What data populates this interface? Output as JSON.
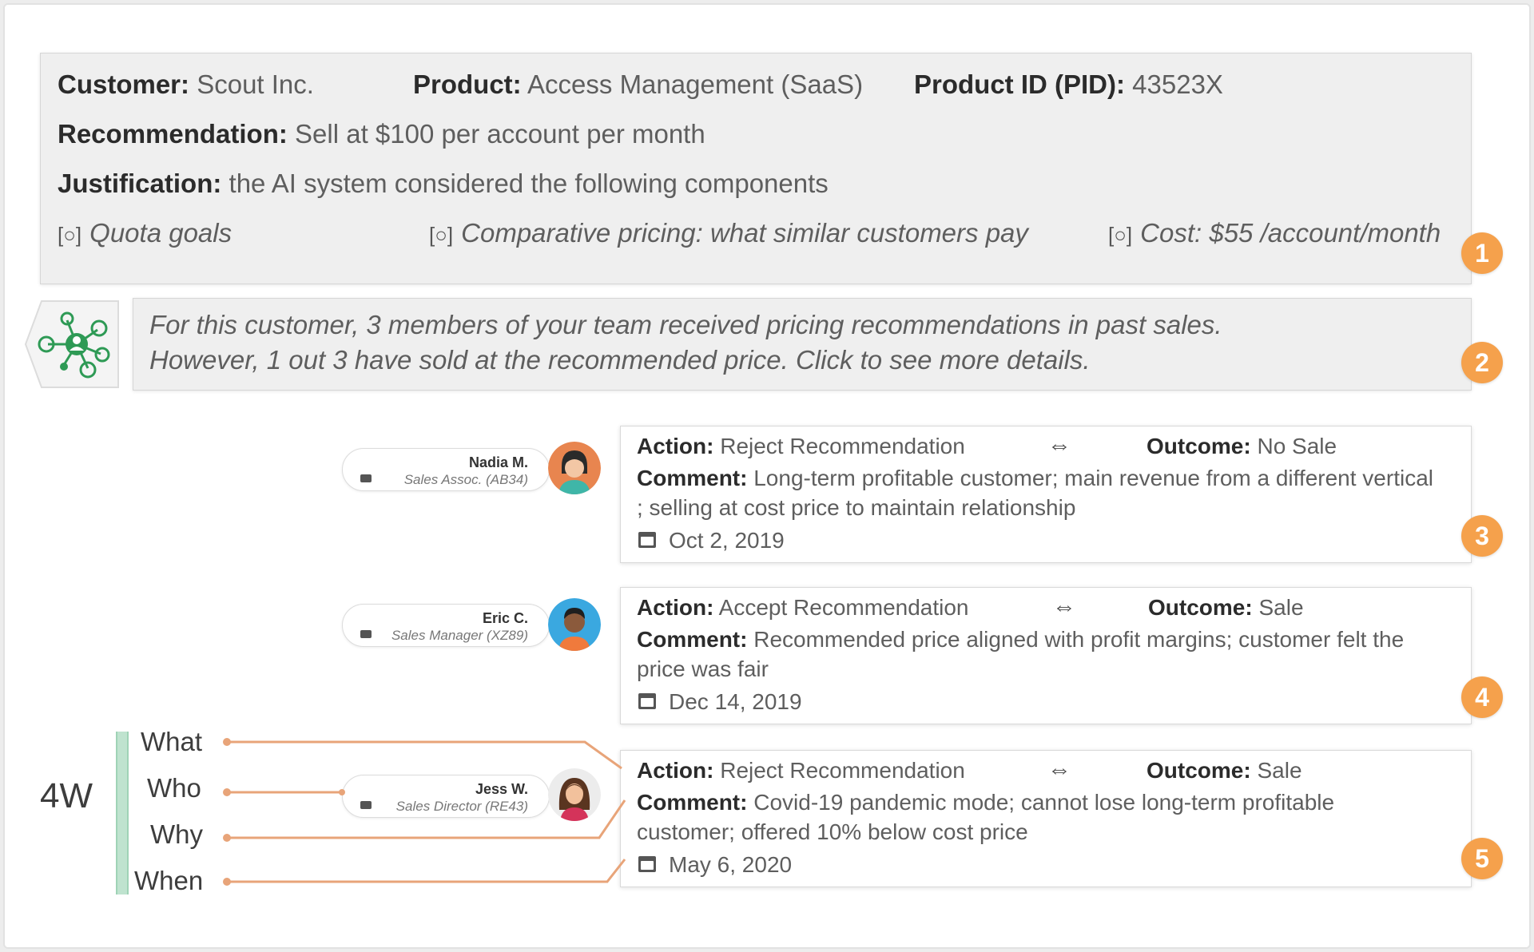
{
  "summary": {
    "customer_label": "Customer:",
    "customer_value": "Scout Inc.",
    "product_label": "Product:",
    "product_value": "Access Management (SaaS)",
    "pid_label": "Product ID (PID):",
    "pid_value": "43523X",
    "recommendation_label": "Recommendation:",
    "recommendation_value": "Sell at $100 per account per month",
    "justification_label": "Justification:",
    "justification_value": "the AI system considered the following components",
    "components": [
      "Quota goals",
      "Comparative pricing: what similar customers pay",
      "Cost: $55 /account/month"
    ],
    "component_icon": "[○]",
    "badge": "1"
  },
  "team_insight": {
    "line1": "For this customer, 3 members of your team received pricing recommendations in past sales.",
    "line2": "However, 1 out 3 have sold at the recommended price. Click to see more details.",
    "icon": "team-network-icon",
    "badge": "2"
  },
  "labels": {
    "action": "Action:",
    "outcome": "Outcome:",
    "comment": "Comment:",
    "swap_symbol": "⇔"
  },
  "records": [
    {
      "name": "Nadia M.",
      "role": "Sales Assoc.  (AB34)",
      "action": "Reject Recommendation",
      "outcome": "No Sale",
      "comment": "Long-term profitable customer; main revenue from a different vertical ; selling at cost price to maintain relationship",
      "date": "Oct 2, 2019",
      "badge": "3"
    },
    {
      "name": "Eric C.",
      "role": "Sales Manager (XZ89)",
      "action": "Accept Recommendation",
      "outcome": "Sale",
      "comment": "Recommended price aligned with profit margins; customer felt the price was fair",
      "date": "Dec 14, 2019",
      "badge": "4"
    },
    {
      "name": "Jess W.",
      "role": "Sales Director (RE43)",
      "action": "Reject Recommendation",
      "outcome": "Sale",
      "comment": "Covid-19 pandemic mode; cannot lose long-term profitable customer; offered 10% below cost price",
      "date": "May 6, 2020",
      "badge": "5"
    }
  ],
  "four_w": {
    "title": "4W",
    "items": [
      "What",
      "Who",
      "Why",
      "When"
    ]
  },
  "colors": {
    "badge": "#f5a14c",
    "connector": "#e8a479",
    "bracket": "#bfe3cf",
    "team_icon": "#2e9a55"
  }
}
